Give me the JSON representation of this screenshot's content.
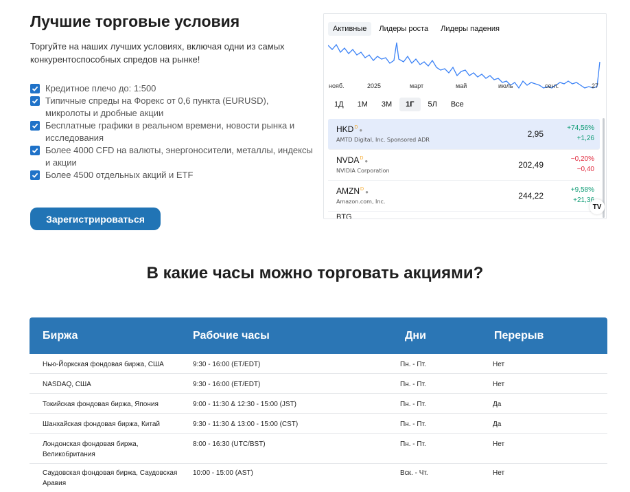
{
  "promo": {
    "title": "Лучшие торговые условия",
    "subtitle": "Торгуйте на наших лучших условиях, включая одни из самых конкурентоспособных спредов на рынке!",
    "features": [
      "Кредитное плечо до: 1:500",
      "Типичные спреды на Форекс от 0,6 пункта (EURUSD), микролоты и дробные акции",
      "Бесплатные графики в реальном времени, новости рынка и исследования",
      "Более 4000 CFD на валюты, энергоносители, металлы, индексы и акции",
      "Более 4500 отдельных акций и ETF"
    ],
    "register_label": "Зарегистрироваться",
    "accent_color": "#2174b5"
  },
  "widget": {
    "tabs": [
      "Активные",
      "Лидеры роста",
      "Лидеры падения"
    ],
    "active_tab": "Активные",
    "axis_labels": [
      "нояб.",
      "2025",
      "март",
      "май",
      "июль",
      "сент.",
      "27"
    ],
    "ranges": [
      "1Д",
      "1М",
      "3М",
      "1Г",
      "5Л",
      "Все"
    ],
    "active_range": "1Г",
    "stocks": [
      {
        "ticker": "HKD",
        "company": "AMTD Digital, Inc. Sponsored ADR",
        "price": "2,95",
        "change_pct": "+74,56%",
        "change_abs": "+1,26",
        "direction": "up"
      },
      {
        "ticker": "NVDA",
        "company": "NVIDIA Corporation",
        "price": "202,49",
        "change_pct": "−0,20%",
        "change_abs": "−0,40",
        "direction": "down"
      },
      {
        "ticker": "AMZN",
        "company": "Amazon.com, Inc.",
        "price": "244,22",
        "change_pct": "+9,58%",
        "change_abs": "+21,36",
        "direction": "up"
      }
    ],
    "delayed_mark": "D",
    "partial_row_text": "BTG",
    "logo_text": "TV",
    "line_color": "#3b82f6"
  },
  "hours": {
    "title": "В какие часы можно торговать акциями?",
    "headers": [
      "Биржа",
      "Рабочие часы",
      "Дни",
      "Перерыв"
    ],
    "rows": [
      [
        "Нью-Йоркская фондовая биржа, США",
        "9:30 - 16:00 (ET/EDT)",
        "Пн. - Пт.",
        "Нет"
      ],
      [
        "NASDAQ, США",
        "9:30 - 16:00 (ET/EDT)",
        "Пн. - Пт.",
        "Нет"
      ],
      [
        "Токийская фондовая биржа, Япония",
        "9:00 - 11:30 & 12:30 - 15:00 (JST)",
        "Пн. - Пт.",
        "Да"
      ],
      [
        "Шанхайская фондовая биржа, Китай",
        "9:30 - 11:30 & 13:00 - 15:00 (CST)",
        "Пн. - Пт.",
        "Да"
      ],
      [
        "Лондонская фондовая биржа, Великобритания",
        "8:00 - 16:30 (UTC/BST)",
        "Пн. - Пт.",
        "Нет"
      ],
      [
        "Саудовская фондовая биржа, Саудовская Аравия",
        "10:00 - 15:00 (AST)",
        "Вск. - Чт.",
        "Нет"
      ]
    ],
    "header_color": "#2b76b5"
  }
}
